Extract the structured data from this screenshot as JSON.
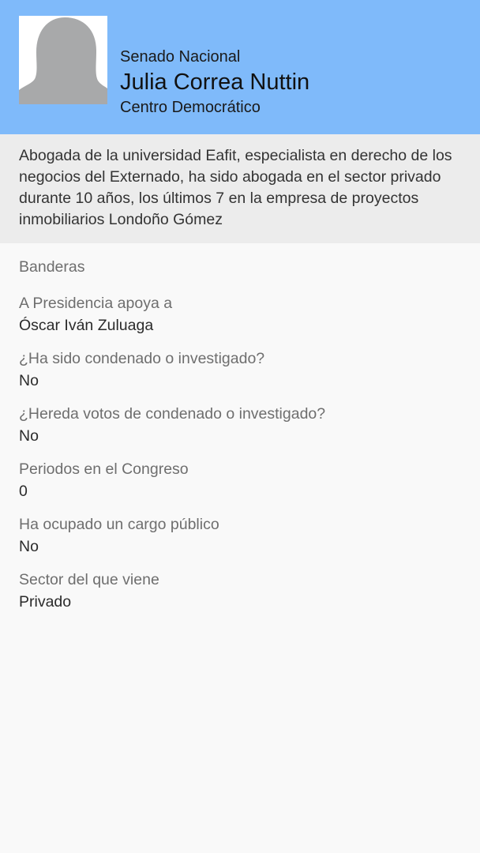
{
  "profile": {
    "chamber": "Senado Nacional",
    "name": "Julia Correa Nuttin",
    "party": "Centro Democrático",
    "avatar_icon": "person-silhouette-icon",
    "bio": "Abogada de la universidad Eafit, especialista en derecho de los negocios del Externado, ha sido abogada en el sector privado durante 10 años, los últimos 7 en la empresa de proyectos inmobiliarios Londoño Gómez"
  },
  "flags": {
    "title": "Banderas",
    "items": [
      {
        "label": "A Presidencia apoya a",
        "value": "Óscar Iván Zuluaga"
      },
      {
        "label": "¿Ha sido condenado o investigado?",
        "value": "No"
      },
      {
        "label": "¿Hereda votos de condenado o investigado?",
        "value": "No"
      },
      {
        "label": "Periodos en el Congreso",
        "value": "0"
      },
      {
        "label": "Ha ocupado un cargo público",
        "value": "No"
      },
      {
        "label": "Sector del que viene",
        "value": "Privado"
      }
    ]
  },
  "colors": {
    "header_bg": "#7fbafa",
    "bio_bg": "#ececec",
    "page_bg": "#f9f9f9",
    "avatar_silhouette": "#a8a9aa"
  }
}
